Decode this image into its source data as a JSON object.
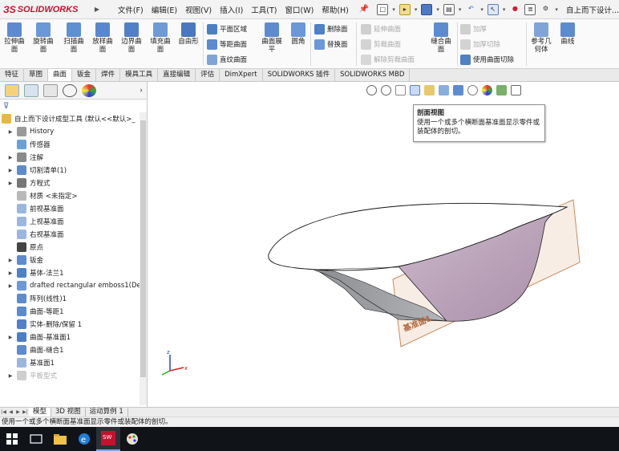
{
  "app": {
    "logo_text": "SOLIDWORKS",
    "doc_title": "自上而下设计...",
    "colors": {
      "logo": "#c8102e",
      "accent": "#2a62c8",
      "plane": "#c88a5a",
      "surface_purple": "#b7a0b7"
    }
  },
  "menu": [
    "文件(F)",
    "编辑(E)",
    "视图(V)",
    "插入(I)",
    "工具(T)",
    "窗口(W)",
    "帮助(H)"
  ],
  "quick_access_icons": [
    "new-document-icon",
    "open-icon",
    "save-icon",
    "print-icon",
    "undo-icon",
    "select-icon",
    "traffic-light-icon",
    "file-properties-icon",
    "options-icon"
  ],
  "command_manager": {
    "large_buttons": [
      "拉伸曲面",
      "旋转曲面",
      "扫描曲面",
      "放样曲面",
      "边界曲面",
      "填充曲面",
      "自由形"
    ],
    "group1": [
      "平面区域",
      "等距曲面",
      "直纹曲面"
    ],
    "group1_large": [
      "曲面展平",
      "圆角"
    ],
    "group2": [
      "删除面",
      "替换面"
    ],
    "group3_disabled": [
      "延伸曲面",
      "剪裁曲面",
      "解除剪裁曲面"
    ],
    "knit": "缝合曲面",
    "group4": {
      "thicken": "加厚",
      "thicken_cut": "加厚切除",
      "cut_with_surface": "使用曲面切除"
    },
    "group5": [
      "参考几何体",
      "曲线"
    ]
  },
  "tabs": [
    "特征",
    "草图",
    "曲面",
    "钣金",
    "焊件",
    "模具工具",
    "直接编辑",
    "评估",
    "DimXpert",
    "SOLIDWORKS 插件",
    "SOLIDWORKS MBD"
  ],
  "active_tab": "曲面",
  "tree": {
    "root": "自上而下设计成型工具  (默认<<默认>_",
    "items": [
      {
        "label": "History",
        "icon": "history-icon",
        "expand": true
      },
      {
        "label": "传感器",
        "icon": "sensor-icon",
        "expand": false
      },
      {
        "label": "注解",
        "icon": "annotation-icon",
        "expand": true
      },
      {
        "label": "切割清单(1)",
        "icon": "cut-list-icon",
        "expand": true
      },
      {
        "label": "方程式",
        "icon": "equation-icon",
        "expand": true
      },
      {
        "label": "材质 <未指定>",
        "icon": "material-icon",
        "expand": false
      },
      {
        "label": "前视基准面",
        "icon": "plane-icon",
        "expand": false
      },
      {
        "label": "上视基准面",
        "icon": "plane-icon",
        "expand": false
      },
      {
        "label": "右视基准面",
        "icon": "plane-icon",
        "expand": false
      },
      {
        "label": "原点",
        "icon": "origin-icon",
        "expand": false
      },
      {
        "label": "钣金",
        "icon": "sheet-metal-icon",
        "expand": true
      },
      {
        "label": "基体-法兰1",
        "icon": "base-flange-icon",
        "expand": true
      },
      {
        "label": "drafted rectangular emboss1(De",
        "icon": "forming-tool-icon",
        "expand": true
      },
      {
        "label": "阵列(线性)1",
        "icon": "linear-pattern-icon",
        "expand": false
      },
      {
        "label": "曲面-等距1",
        "icon": "offset-surface-icon",
        "expand": false
      },
      {
        "label": "实体-删除/保留 1",
        "icon": "delete-body-icon",
        "expand": false
      },
      {
        "label": "曲面-基准面1",
        "icon": "planar-surface-icon",
        "expand": true
      },
      {
        "label": "曲面-缝合1",
        "icon": "knit-surface-icon",
        "expand": false
      },
      {
        "label": "基准面1",
        "icon": "plane-icon",
        "expand": false
      },
      {
        "label": "平板型式",
        "icon": "flat-pattern-icon",
        "expand": true,
        "faded": true
      }
    ]
  },
  "heads_up_icons": [
    "zoom-fit-icon",
    "zoom-area-icon",
    "previous-view-icon",
    "section-view-icon",
    "dynamic-annotation-icon",
    "view-orientation-icon",
    "display-style-icon",
    "hide-show-icon",
    "edit-appearance-icon",
    "apply-scene-icon",
    "view-settings-icon"
  ],
  "tooltip": {
    "title": "剖面视图",
    "body": "使用一个或多个横断面基准面显示零件或装配体的剖切。"
  },
  "viewport": {
    "plane_label": "基准面1"
  },
  "bottom_tabs": [
    "模型",
    "3D 视图",
    "运动算例 1"
  ],
  "status": "使用一个或多个横断面基准面显示零件或装配体的剖切。",
  "taskbar": [
    "windows-start-icon",
    "task-view-icon",
    "file-explorer-icon",
    "edge-icon",
    "solidworks-2016-icon",
    "paint-icon"
  ]
}
